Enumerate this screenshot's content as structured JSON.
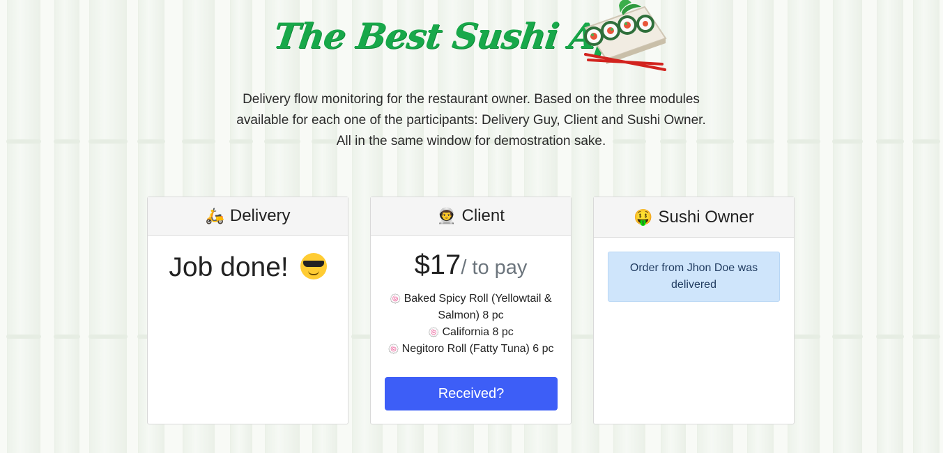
{
  "header": {
    "title": "The Best Sushi App",
    "description": "Delivery flow monitoring for the restaurant owner. Based on the three modules available for each one of the participants: Delivery Guy, Client and Sushi Owner. All in the same window for demostration sake."
  },
  "delivery": {
    "icon": "🛵",
    "title": "Delivery",
    "status": "Job done!"
  },
  "client": {
    "icon": "👨‍🚀",
    "title": "Client",
    "amount": "$17",
    "amount_suffix": "/ to pay",
    "item_icon": "🍥",
    "items": [
      "Baked Spicy Roll (Yellowtail & Salmon) 8 pc",
      "California 8 pc",
      "Negitoro Roll (Fatty Tuna) 6 pc"
    ],
    "button_label": "Received?"
  },
  "owner": {
    "icon": "🤑",
    "title": "Sushi Owner",
    "alert": "Order from Jhon Doe was delivered"
  },
  "colors": {
    "title_green": "#18a84a",
    "button_blue": "#3d5ef7",
    "alert_bg": "#cfe5fb"
  }
}
